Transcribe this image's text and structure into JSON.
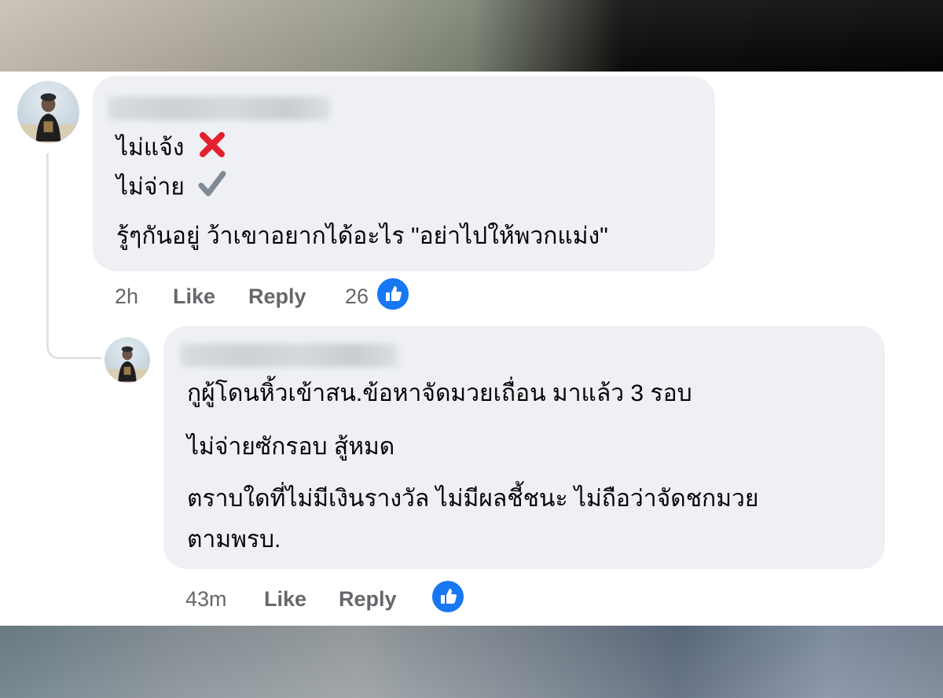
{
  "comment": {
    "author": "",
    "lines": [
      "ไม่แจ้ง",
      "ไม่จ่าย",
      "รู้ๆกันอยู่ ว้าเขาอยากได้อะไร \"อย่าไปให้พวกแม่ง\""
    ],
    "marks": [
      "cross-mark-icon",
      "check-mark-icon"
    ],
    "time": "2h",
    "like_label": "Like",
    "reply_label": "Reply",
    "reaction_count": "26"
  },
  "reply": {
    "author": "",
    "lines": [
      "กูผู้โดนหิ้วเข้าสน.ข้อหาจัดมวยเถื่อน มาแล้ว 3 รอบ",
      "ไม่จ่ายซักรอบ สู้หมด",
      "ตราบใดที่ไม่มีเงินรางวัล ไม่มีผลชี้ชนะ ไม่ถือว่าจัดชกมวย",
      "ตามพรบ."
    ],
    "time": "43m",
    "like_label": "Like",
    "reply_label": "Reply"
  },
  "colors": {
    "bubble": "#eef0f4",
    "meta_text": "#65676b",
    "like_blue": "#1877f2",
    "cross_red": "#e5202e",
    "check_gray": "#7f8a96"
  }
}
